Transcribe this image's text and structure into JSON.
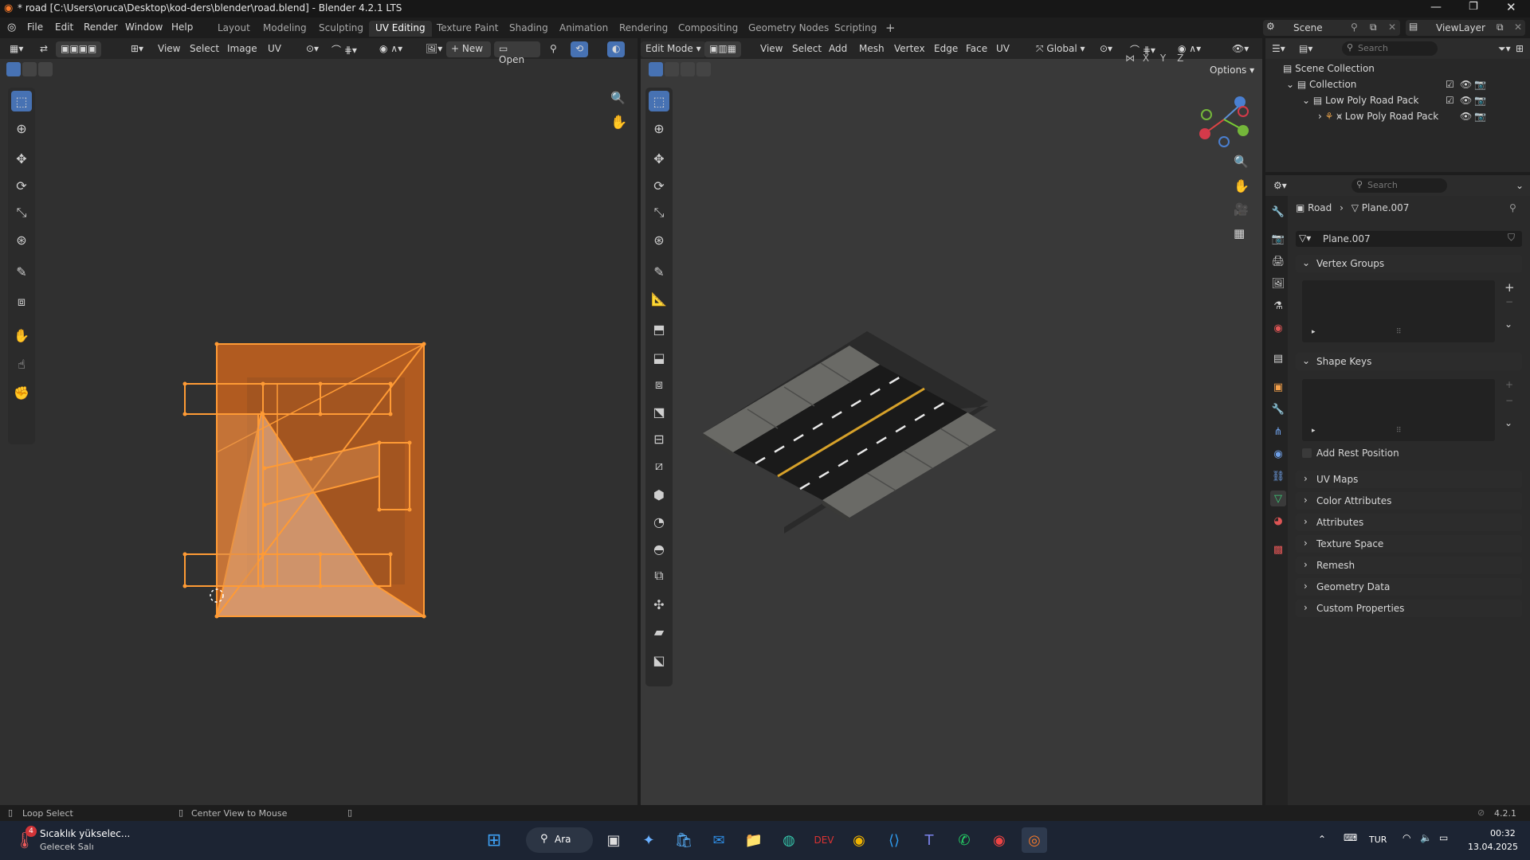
{
  "window": {
    "title": "* road [C:\\Users\\oruca\\Desktop\\kod-ders\\blender\\road.blend] - Blender 4.2.1 LTS"
  },
  "menus": [
    "File",
    "Edit",
    "Render",
    "Window",
    "Help"
  ],
  "workspaces": [
    "Layout",
    "Modeling",
    "Sculpting",
    "UV Editing",
    "Texture Paint",
    "Shading",
    "Animation",
    "Rendering",
    "Compositing",
    "Geometry Nodes",
    "Scripting"
  ],
  "active_workspace": "UV Editing",
  "scene": {
    "name": "Scene",
    "view_layer": "ViewLayer"
  },
  "uv_editor": {
    "menus": [
      "View",
      "Select",
      "Image",
      "UV"
    ],
    "new_label": "New",
    "open_label": "Open"
  },
  "viewport": {
    "mode": "Edit Mode",
    "menus": [
      "View",
      "Select",
      "Add",
      "Mesh",
      "Vertex",
      "Edge",
      "Face",
      "UV"
    ],
    "orientation": "Global",
    "axes": [
      "X",
      "Y",
      "Z"
    ],
    "options_label": "Options"
  },
  "outliner": {
    "search_placeholder": "Search",
    "items": [
      {
        "label": "Scene Collection"
      },
      {
        "label": "Collection"
      },
      {
        "label": "Low Poly Road Pack"
      },
      {
        "label": "Low Poly Road Pack"
      }
    ]
  },
  "properties": {
    "search_placeholder": "Search",
    "breadcrumb_object": "Road",
    "breadcrumb_mesh": "Plane.007",
    "mesh_name": "Plane.007",
    "vertex_groups": "Vertex Groups",
    "shape_keys": "Shape Keys",
    "add_rest_position": "Add Rest Position",
    "sections": [
      "UV Maps",
      "Color Attributes",
      "Attributes",
      "Texture Space",
      "Remesh",
      "Geometry Data",
      "Custom Properties"
    ]
  },
  "statusbar": {
    "left_hint": "Loop Select",
    "middle_hint": "Center View to Mouse",
    "version": "4.2.1"
  },
  "taskbar": {
    "weather_title": "Sıcaklık yükselec...",
    "weather_sub": "Gelecek Salı",
    "weather_badge": "4",
    "search_label": "Ara",
    "language": "TUR",
    "time": "00:32",
    "date": "13.04.2025"
  },
  "colors": {
    "accent": "#4772b3",
    "uv_orange": "#e07a1f",
    "road_asphalt": "#1a1a1a",
    "road_yellow": "#d6a12a"
  }
}
